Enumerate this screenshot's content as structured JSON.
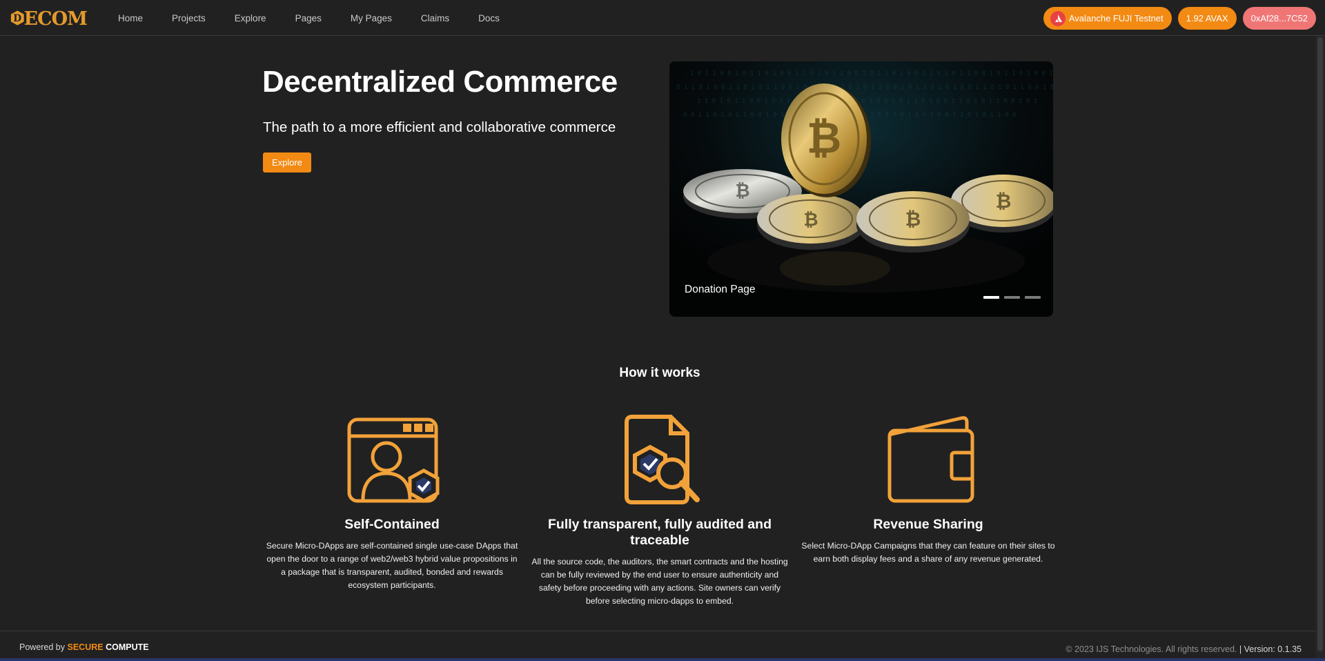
{
  "brand": {
    "logo_letter": "D",
    "logo_text": "ECOM",
    "accent": "#f28a14"
  },
  "nav": {
    "links": [
      "Home",
      "Projects",
      "Explore",
      "Pages",
      "My Pages",
      "Claims",
      "Docs"
    ],
    "network": "Avalanche FUJI Testnet",
    "balance": "1.92 AVAX",
    "address": "0xAf28...7C52"
  },
  "hero": {
    "title": "Decentralized Commerce",
    "subtitle": "The path to a more efficient and collaborative commerce",
    "cta": "Explore"
  },
  "carousel": {
    "caption": "Donation Page",
    "slide_count": 3,
    "active_index": 0
  },
  "how_it_works": {
    "title": "How it works",
    "features": [
      {
        "icon": "self-contained-icon",
        "title": "Self-Contained",
        "description": "Secure Micro-DApps are self-contained single use-case DApps that open the door to a range of web2/web3 hybrid value propositions in a package that is transparent, audited, bonded and rewards ecosystem participants."
      },
      {
        "icon": "audit-search-icon",
        "title": "Fully transparent, fully audited and traceable",
        "description": "All the source code, the auditors, the smart contracts and the hosting can be fully reviewed by the end user to ensure authenticity and safety before proceeding with any actions. Site owners can verify before selecting micro-dapps to embed."
      },
      {
        "icon": "wallet-icon",
        "title": "Revenue Sharing",
        "description": "Select Micro-DApp Campaigns that they can feature on their sites to earn both display fees and a share of any revenue generated."
      }
    ]
  },
  "footer": {
    "powered_by": "Powered by",
    "brand_secure": "SECURE",
    "brand_compute": "COMPUTE",
    "copyright": "© 2023 IJS Technologies. All rights reserved.",
    "separator": "|",
    "version": "Version: 0.1.35"
  }
}
